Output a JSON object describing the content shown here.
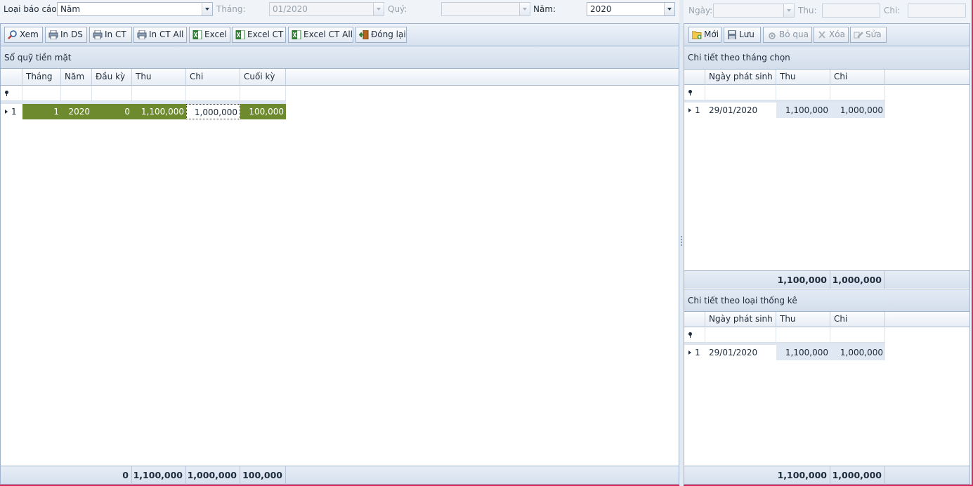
{
  "filters": {
    "report_type_label": "Loại báo cáo:",
    "report_type_value": "Năm",
    "month_label": "Tháng:",
    "month_value": "01/2020",
    "quarter_label": "Quý:",
    "quarter_value": "",
    "year_label": "Năm:",
    "year_value": "2020"
  },
  "right_filters": {
    "date_label": "Ngày:",
    "income_label": "Thu:",
    "expense_label": "Chi:"
  },
  "left_toolbar": [
    {
      "label": "Xem",
      "icon": "magnifier-icon"
    },
    {
      "label": "In DS",
      "icon": "printer-icon"
    },
    {
      "label": "In CT",
      "icon": "printer-icon"
    },
    {
      "label": "In CT All",
      "icon": "printer-icon"
    },
    {
      "label": "Excel",
      "icon": "excel-icon"
    },
    {
      "label": "Excel CT",
      "icon": "excel-icon"
    },
    {
      "label": "Excel CT All",
      "icon": "excel-icon"
    },
    {
      "label": "Đóng lại",
      "icon": "exit-door-icon"
    }
  ],
  "right_toolbar": [
    {
      "label": "Mới",
      "icon": "new-folder-icon"
    },
    {
      "label": "Lưu",
      "icon": "save-disk-icon"
    },
    {
      "label": "Bỏ qua",
      "icon": "skip-icon"
    },
    {
      "label": "Xóa",
      "icon": "delete-icon"
    },
    {
      "label": "Sửa",
      "icon": "edit-icon"
    }
  ],
  "main_grid": {
    "caption": "Sổ quỹ tiền mặt",
    "columns": [
      "Tháng",
      "Năm",
      "Đầu kỳ",
      "Thu",
      "Chi",
      "Cuối kỳ"
    ],
    "rows": [
      {
        "index": "1",
        "cells": [
          "1",
          "2020",
          "0",
          "1,100,000",
          "1,000,000",
          "100,000"
        ]
      }
    ],
    "totals": [
      "0",
      "1,100,000",
      "1,000,000",
      "100,000"
    ]
  },
  "month_detail": {
    "caption": "Chi tiết theo tháng chọn",
    "columns": [
      "Ngày phát sinh",
      "Thu",
      "Chi"
    ],
    "rows": [
      {
        "index": "1",
        "cells": [
          "29/01/2020",
          "1,100,000",
          "1,000,000"
        ]
      }
    ],
    "totals": [
      "1,100,000",
      "1,000,000"
    ]
  },
  "type_detail": {
    "caption": "Chi tiết theo loại thống kê",
    "columns": [
      "Ngày phát sinh",
      "Thu",
      "Chi"
    ],
    "rows": [
      {
        "index": "1",
        "cells": [
          "29/01/2020",
          "1,100,000",
          "1,000,000"
        ]
      }
    ],
    "totals": [
      "1,100,000",
      "1,000,000"
    ]
  },
  "colors": {
    "selected_row": "#6d8b2e",
    "accent_border": "#d9265b"
  }
}
